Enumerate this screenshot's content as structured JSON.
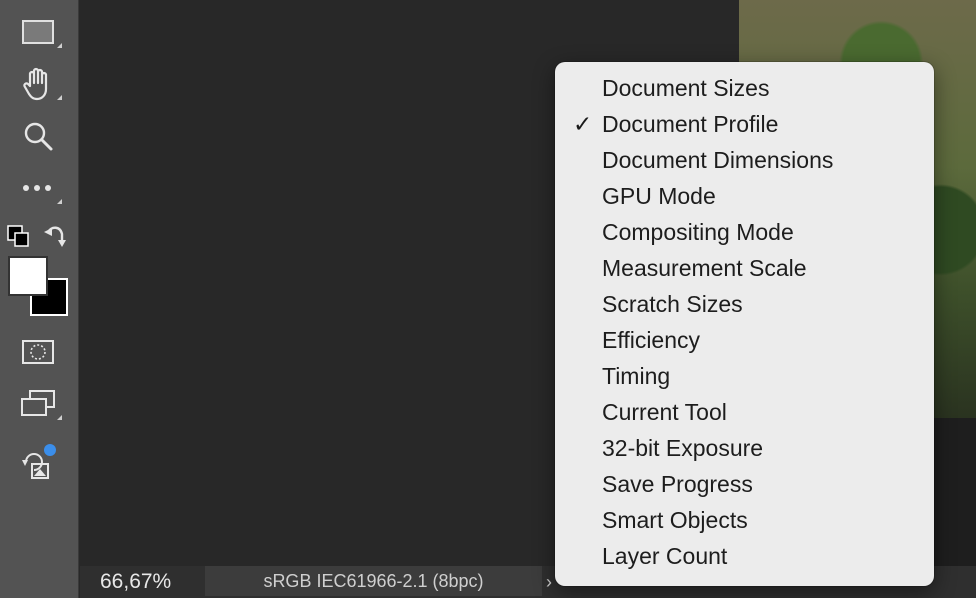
{
  "toolbar": {
    "tools": [
      {
        "name": "rectangle-tool",
        "icon": "rectangle-icon"
      },
      {
        "name": "hand-tool",
        "icon": "hand-icon"
      },
      {
        "name": "zoom-tool",
        "icon": "magnifier-icon"
      },
      {
        "name": "more-tools",
        "icon": "more-icon"
      },
      {
        "name": "default-colors",
        "icon": "default-colors-icon"
      },
      {
        "name": "swap-colors",
        "icon": "swap-arrow-icon"
      },
      {
        "name": "color-swatches",
        "foreground": "#ffffff",
        "background": "#000000"
      },
      {
        "name": "quick-mask",
        "icon": "quick-mask-icon"
      },
      {
        "name": "screen-mode",
        "icon": "screen-mode-icon"
      },
      {
        "name": "generative-fill",
        "icon": "generative-image-icon",
        "badge_color": "#3b8eea"
      }
    ]
  },
  "status_bar": {
    "zoom": "66,67%",
    "profile": "sRGB IEC61966-2.1 (8bpc)",
    "arrow": "›"
  },
  "menu": {
    "check_mark": "✓",
    "items": [
      {
        "label": "Document Sizes",
        "checked": false
      },
      {
        "label": "Document Profile",
        "checked": true
      },
      {
        "label": "Document Dimensions",
        "checked": false
      },
      {
        "label": "GPU Mode",
        "checked": false
      },
      {
        "label": "Compositing Mode",
        "checked": false
      },
      {
        "label": "Measurement Scale",
        "checked": false
      },
      {
        "label": "Scratch Sizes",
        "checked": false
      },
      {
        "label": "Efficiency",
        "checked": false
      },
      {
        "label": "Timing",
        "checked": false
      },
      {
        "label": "Current Tool",
        "checked": false
      },
      {
        "label": "32-bit Exposure",
        "checked": false
      },
      {
        "label": "Save Progress",
        "checked": false
      },
      {
        "label": "Smart Objects",
        "checked": false
      },
      {
        "label": "Layer Count",
        "checked": false
      }
    ]
  },
  "colors": {
    "toolbar_bg": "#535353",
    "canvas_bg": "#282828",
    "menu_bg": "#ececec",
    "badge_blue": "#3b8eea"
  }
}
